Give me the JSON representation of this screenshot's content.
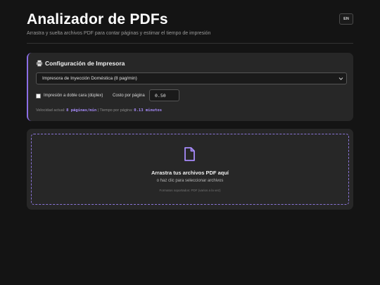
{
  "header": {
    "title": "Analizador de PDFs",
    "subtitle": "Arrastra y suelta archivos PDF para contar páginas y estimar el tiempo de impresión",
    "lang_button": "EN"
  },
  "config": {
    "title": "Configuración de Impresora",
    "title_icon": "printer-icon",
    "printer_select": "Impresora de Inyección Doméstica (8 pag/min)",
    "duplex_label": "Impresión a doble cara (dúplex)",
    "duplex_checked": false,
    "cost_label": "Costo por página",
    "cost_value": "0.50",
    "speed_prefix": "Velocidad actual:",
    "speed_value": "8 páginas/min",
    "time_prefix": "| Tiempo por página:",
    "time_value": "0.13 minutos"
  },
  "dropzone": {
    "icon": "file-icon",
    "title": "Arrastra tus archivos PDF aquí",
    "subtitle": "o haz clic para seleccionar archivos",
    "formats": "Formatos soportados: PDF (varios a la vez)"
  },
  "colors": {
    "accent": "#8b6ee6",
    "accent_text": "#a78bfa",
    "background": "#141414",
    "card": "#272727"
  }
}
